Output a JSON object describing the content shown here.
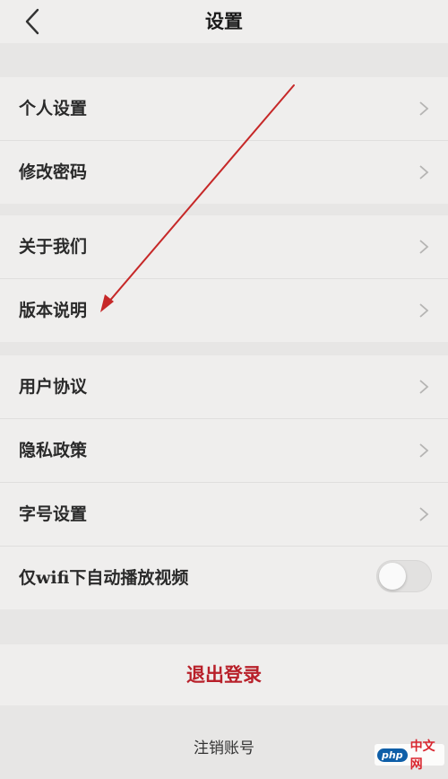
{
  "header": {
    "title": "设置"
  },
  "groups": [
    {
      "items": [
        {
          "label": "个人设置"
        },
        {
          "label": "修改密码"
        }
      ]
    },
    {
      "items": [
        {
          "label": "关于我们"
        },
        {
          "label": "版本说明"
        }
      ]
    },
    {
      "items": [
        {
          "label": "用户协议"
        },
        {
          "label": "隐私政策"
        },
        {
          "label": "字号设置"
        },
        {
          "label": "仅wifi下自动播放视频",
          "toggle": "off"
        }
      ]
    }
  ],
  "actions": {
    "logout": "退出登录",
    "cancel_account": "注销账号"
  },
  "watermark": {
    "badge": "php",
    "text": "中文网"
  },
  "colors": {
    "accent": "#b8202a",
    "annotation_arrow": "#c62828",
    "background": "#e7e6e5",
    "row": "#efeeed"
  }
}
